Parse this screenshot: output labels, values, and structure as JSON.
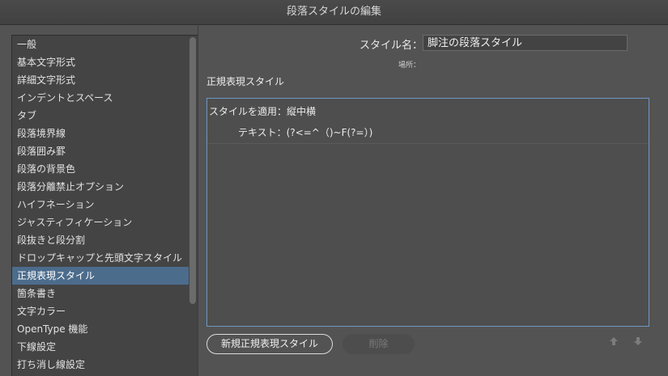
{
  "window": {
    "title": "段落スタイルの編集"
  },
  "sidebar": {
    "items": [
      {
        "label": "一般"
      },
      {
        "label": "基本文字形式"
      },
      {
        "label": "詳細文字形式"
      },
      {
        "label": "インデントとスペース"
      },
      {
        "label": "タブ"
      },
      {
        "label": "段落境界線"
      },
      {
        "label": "段落囲み罫"
      },
      {
        "label": "段落の背景色"
      },
      {
        "label": "段落分離禁止オプション"
      },
      {
        "label": "ハイフネーション"
      },
      {
        "label": "ジャスティフィケーション"
      },
      {
        "label": "段抜きと段分割"
      },
      {
        "label": "ドロップキャップと先頭文字スタイル"
      },
      {
        "label": "正規表現スタイル",
        "selected": true
      },
      {
        "label": "箇条書き"
      },
      {
        "label": "文字カラー"
      },
      {
        "label": "OpenType 機能"
      },
      {
        "label": "下線設定"
      },
      {
        "label": "打ち消し線設定"
      }
    ]
  },
  "header": {
    "style_name_label": "スタイル名：",
    "style_name_value": "脚注の段落スタイル",
    "location_label": "場所："
  },
  "section": {
    "title": "正規表現スタイル"
  },
  "regex": {
    "apply_style": "スタイルを適用：縦中横",
    "text_pattern": "テキスト：(?<=^（)~F(?=）)"
  },
  "buttons": {
    "new_label": "新規正規表現スタイル",
    "delete_label": "削除"
  },
  "colors": {
    "selection": "#4c6c8c",
    "panel_border": "#6f97c4"
  }
}
